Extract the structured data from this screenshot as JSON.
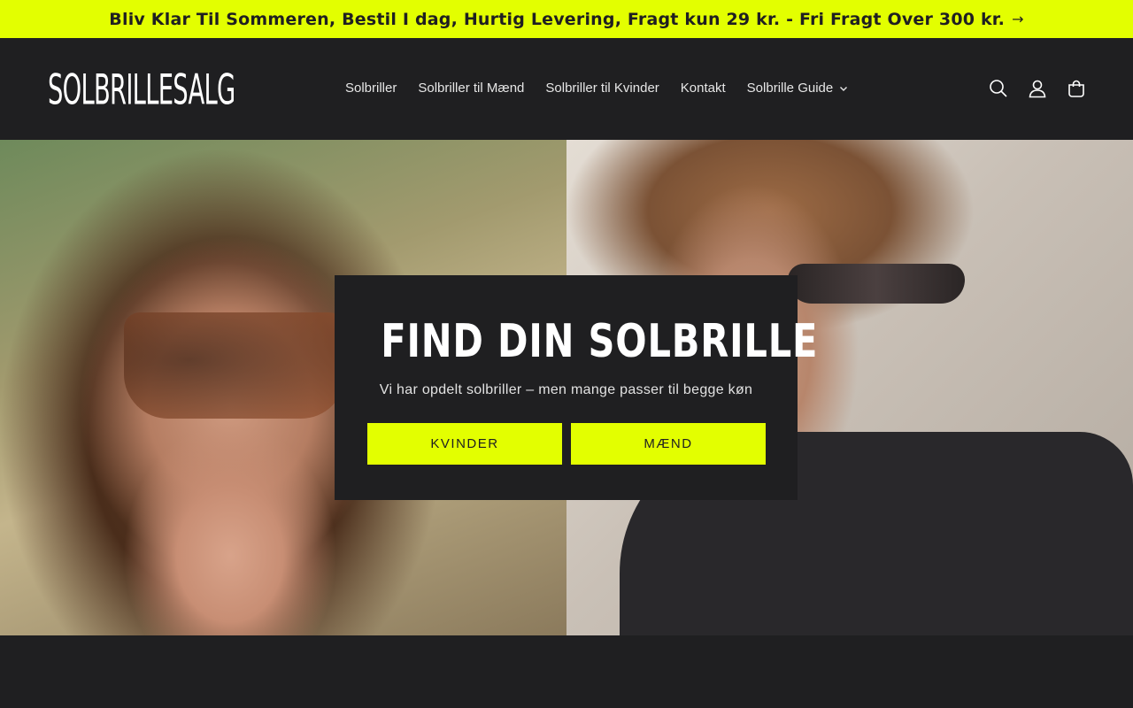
{
  "announcement": {
    "text": "Bliv Klar Til Sommeren, Bestil I dag, Hurtig Levering, Fragt kun 29 kr. - Fri Fragt Over 300 kr.",
    "arrow": "→"
  },
  "header": {
    "logo": "SOLBRILLESALG",
    "nav": [
      {
        "label": "Solbriller"
      },
      {
        "label": "Solbriller til Mænd"
      },
      {
        "label": "Solbriller til Kvinder"
      },
      {
        "label": "Kontakt"
      },
      {
        "label": "Solbrille Guide"
      }
    ],
    "icons": [
      "search-icon",
      "account-icon",
      "cart-icon"
    ]
  },
  "hero": {
    "title": "FIND DIN SOLBRILLE",
    "subtitle": "Vi har opdelt solbriller – men mange passer til begge køn",
    "buttons": {
      "women": "KVINDER",
      "men": "MÆND"
    }
  },
  "colors": {
    "accent": "#e3ff00",
    "background": "#1f1f21",
    "text": "#ffffff"
  }
}
